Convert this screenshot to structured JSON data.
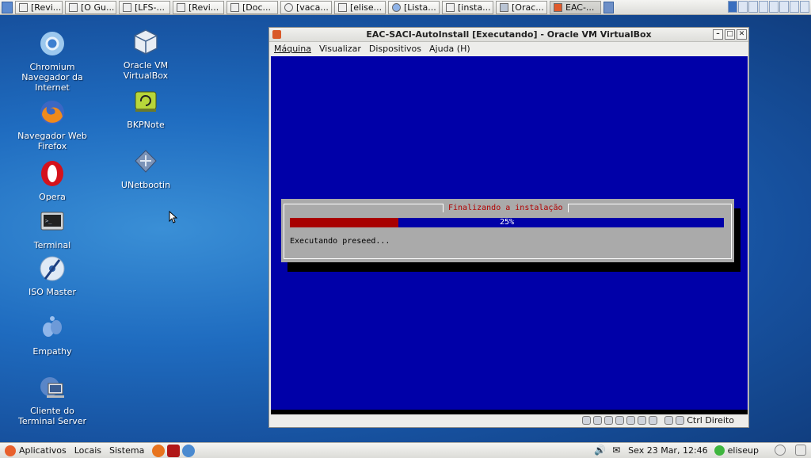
{
  "top_panel": {
    "tasks": [
      "[Revi...",
      "[O Gu...",
      "[LFS-...",
      "[Revi...",
      "[Doc...",
      "[vaca...",
      "[elise...",
      "[Lista...",
      "[insta...",
      "[Orac...",
      "EAC-..."
    ]
  },
  "desktop": {
    "icons": [
      {
        "label": "Chromium Navegador da Internet",
        "icon": "chromium-icon"
      },
      {
        "label": "Navegador Web Firefox",
        "icon": "firefox-icon"
      },
      {
        "label": "Opera",
        "icon": "opera-icon"
      },
      {
        "label": "Terminal",
        "icon": "terminal-icon"
      },
      {
        "label": "ISO Master",
        "icon": "iso-master-icon"
      },
      {
        "label": "Empathy",
        "icon": "empathy-icon"
      },
      {
        "label": "Cliente do Terminal Server",
        "icon": "terminal-server-icon"
      },
      {
        "label": "Oracle VM VirtualBox",
        "icon": "virtualbox-icon"
      },
      {
        "label": "BKPNote",
        "icon": "bkpnote-icon"
      },
      {
        "label": "UNetbootin",
        "icon": "unetbootin-icon"
      }
    ]
  },
  "vm_window": {
    "title": "EAC-SACI-AutoInstall [Executando] - Oracle VM VirtualBox",
    "menu": [
      "Máquina",
      "Visualizar",
      "Dispositivos",
      "Ajuda (H)"
    ],
    "dialog": {
      "title": "Finalizando a instalação",
      "progress_percent": 25,
      "progress_label": "25%",
      "message": "Executando preseed..."
    },
    "host_key_label": "Ctrl Direito"
  },
  "bottom_panel": {
    "menus": [
      "Aplicativos",
      "Locais",
      "Sistema"
    ],
    "clock": "Sex 23 Mar, 12:46",
    "user": "eliseup"
  },
  "colors": {
    "vm_background": "#0000a8",
    "progress_fill": "#a80000",
    "dialog_gray": "#aaaaaa",
    "dialog_title": "#b00000"
  }
}
